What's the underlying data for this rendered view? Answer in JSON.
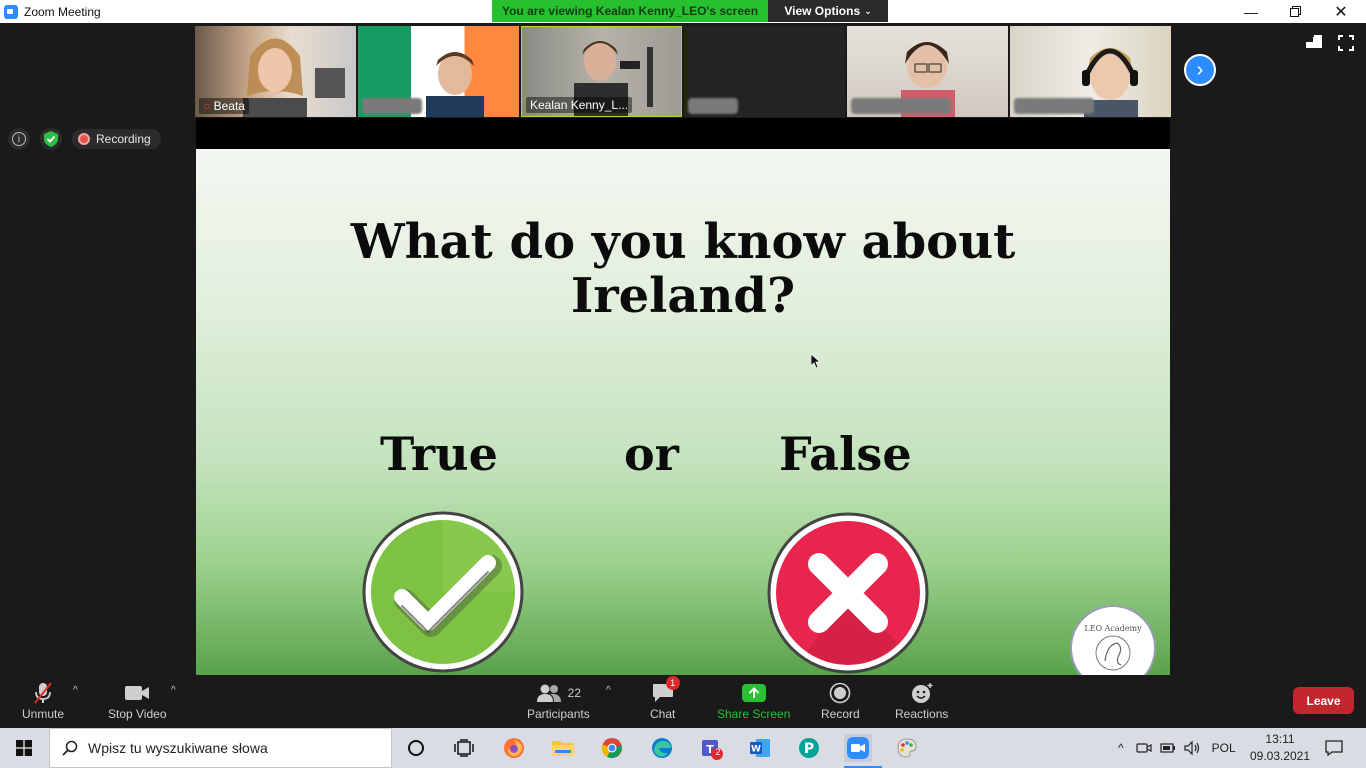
{
  "window": {
    "title": "Zoom Meeting",
    "banner": "You are viewing Kealan Kenny_LEO's screen",
    "view_options": "View Options"
  },
  "participants_strip": [
    {
      "name": "Beata",
      "muted": true
    },
    {
      "name": "",
      "muted": false
    },
    {
      "name": "Kealan Kenny_L...",
      "muted": false
    },
    {
      "name": "",
      "muted": false
    },
    {
      "name": "",
      "muted": false
    },
    {
      "name": "",
      "muted": false
    }
  ],
  "status": {
    "recording": "Recording"
  },
  "slide": {
    "title_line1": "What do you know about",
    "title_line2": "Ireland?",
    "word_true": "True",
    "word_or": "or",
    "word_false": "False",
    "logo_text": "LEO Academy"
  },
  "controls": {
    "unmute": "Unmute",
    "stop_video": "Stop Video",
    "participants": "Participants",
    "participants_count": "22",
    "chat": "Chat",
    "chat_badge": "1",
    "share_screen": "Share Screen",
    "record": "Record",
    "reactions": "Reactions",
    "leave": "Leave"
  },
  "taskbar": {
    "search_placeholder": "Wpisz tu wyszukiwane słowa",
    "teams_badge": "2",
    "language": "POL",
    "time": "13:11",
    "date": "09.03.2021"
  },
  "colors": {
    "accent_blue": "#2d8cff",
    "banner_green": "#27c12f",
    "leave_red": "#c1272d",
    "check_green": "#7dc242",
    "cross_red": "#e8264d"
  }
}
